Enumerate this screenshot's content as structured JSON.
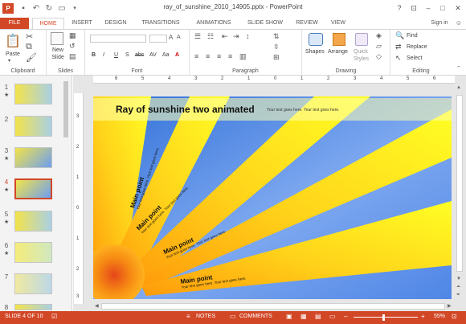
{
  "app": {
    "title": "ray_of_sunshine_2010_14905.pptx - PowerPoint",
    "signin": "Sign in",
    "help": "?"
  },
  "tabs": [
    "FILE",
    "HOME",
    "INSERT",
    "DESIGN",
    "TRANSITIONS",
    "ANIMATIONS",
    "SLIDE SHOW",
    "REVIEW",
    "VIEW"
  ],
  "ribbon": {
    "clipboard": {
      "label": "Clipboard",
      "paste": "Paste"
    },
    "slides": {
      "label": "Slides",
      "new_slide_1": "New",
      "new_slide_2": "Slide"
    },
    "font": {
      "label": "Font",
      "bold": "B",
      "italic": "I",
      "underline": "U",
      "strike": "S",
      "abc": "abc",
      "aa": "Aa"
    },
    "paragraph": {
      "label": "Paragraph"
    },
    "drawing": {
      "label": "Drawing",
      "shapes": "Shapes",
      "arrange": "Arrange",
      "quick_1": "Quick",
      "quick_2": "Styles"
    },
    "editing": {
      "label": "Editing",
      "find": "Find",
      "replace": "Replace",
      "select": "Select"
    }
  },
  "thumbnails": [
    {
      "num": "1",
      "star": "★"
    },
    {
      "num": "2",
      "star": ""
    },
    {
      "num": "3",
      "star": "★"
    },
    {
      "num": "4",
      "star": "★"
    },
    {
      "num": "5",
      "star": "★"
    },
    {
      "num": "6",
      "star": "★"
    },
    {
      "num": "7",
      "star": ""
    },
    {
      "num": "8",
      "star": ""
    }
  ],
  "ruler_h": [
    "6",
    "5",
    "4",
    "3",
    "2",
    "1",
    "0",
    "1",
    "2",
    "3",
    "4",
    "5",
    "6"
  ],
  "ruler_v": [
    "3",
    "2",
    "1",
    "0",
    "1",
    "2",
    "3"
  ],
  "slide": {
    "title": "Ray of sunshine two animated",
    "subtitle": "Your text goes here. Your text goes here.",
    "points": [
      {
        "head": "Main point",
        "body": "Your text goes here. Your text goes here."
      },
      {
        "head": "Main point",
        "body": "Your text goes here. Your text goes here."
      },
      {
        "head": "Main point",
        "body": "Your text goes here. Your text goes here."
      },
      {
        "head": "Main point",
        "body": "Your text goes here. Your text goes here."
      }
    ]
  },
  "status": {
    "slide": "SLIDE 4 OF 10",
    "notes": "NOTES",
    "comments": "COMMENTS",
    "zoom": "55%"
  },
  "colors": {
    "accent": "#d24726",
    "ray": "#ffff1e",
    "sky": "#6d9ff0"
  }
}
